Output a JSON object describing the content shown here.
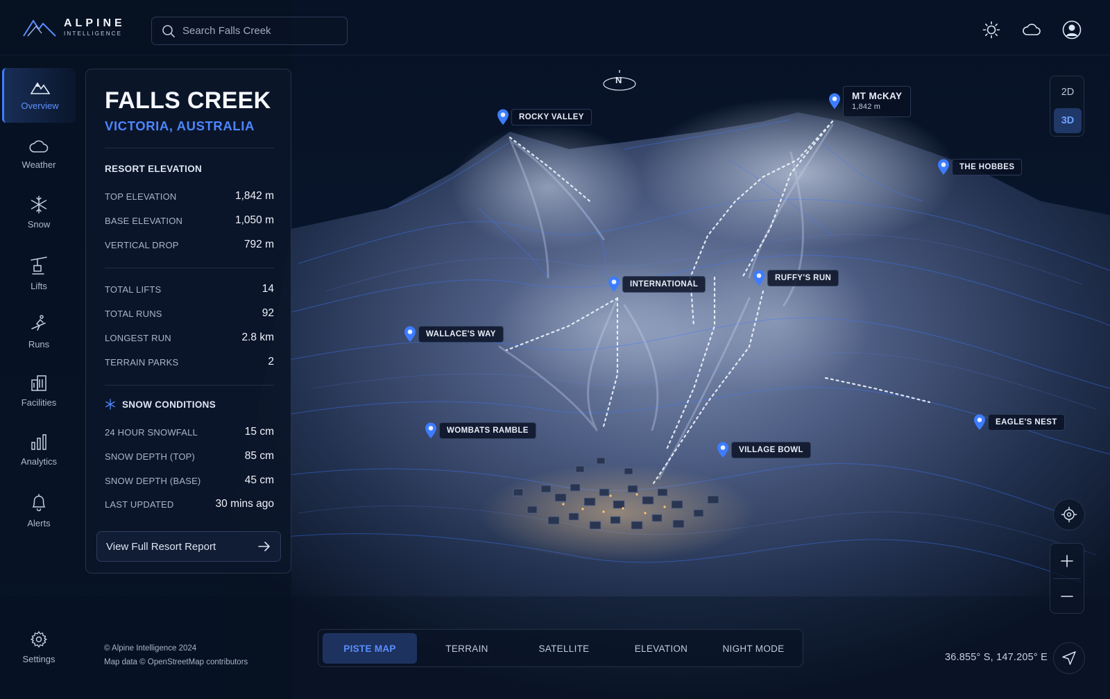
{
  "brand": {
    "name": "ALPINE",
    "tagline": "INTELLIGENCE"
  },
  "search": {
    "placeholder": "Search Falls Creek"
  },
  "header_icons": [
    "sun-icon",
    "cloud-icon",
    "user-icon"
  ],
  "nav": {
    "items": [
      {
        "label": "Overview",
        "icon": "mountain-icon",
        "active": true
      },
      {
        "label": "Weather",
        "icon": "cloud-icon"
      },
      {
        "label": "Snow",
        "icon": "snowflake-icon"
      },
      {
        "label": "Lifts",
        "icon": "chairlift-icon"
      },
      {
        "label": "Runs",
        "icon": "skier-icon"
      },
      {
        "label": "Facilities",
        "icon": "building-icon"
      },
      {
        "label": "Analytics",
        "icon": "bar-chart-icon"
      },
      {
        "label": "Alerts",
        "icon": "bell-icon"
      }
    ],
    "settings": "Settings"
  },
  "resort": {
    "name": "FALLS CREEK",
    "region": "VICTORIA, AUSTRALIA",
    "elevation_title": "RESORT ELEVATION",
    "elevation": [
      {
        "label": "TOP ELEVATION",
        "value": "1,842 m"
      },
      {
        "label": "BASE ELEVATION",
        "value": "1,050 m"
      },
      {
        "label": "VERTICAL DROP",
        "value": "792 m"
      }
    ],
    "stats": [
      {
        "label": "TOTAL LIFTS",
        "value": "14"
      },
      {
        "label": "TOTAL RUNS",
        "value": "92"
      },
      {
        "label": "LONGEST RUN",
        "value": "2.8 km"
      },
      {
        "label": "TERRAIN PARKS",
        "value": "2"
      }
    ],
    "snow_title": "SNOW CONDITIONS",
    "snow": [
      {
        "label": "24 HOUR SNOWFALL",
        "value": "15 cm"
      },
      {
        "label": "SNOW DEPTH (TOP)",
        "value": "85 cm"
      },
      {
        "label": "SNOW DEPTH (BASE)",
        "value": "45 cm"
      },
      {
        "label": "LAST UPDATED",
        "value": "30 mins ago"
      }
    ],
    "report_button": "View Full Resort Report"
  },
  "map": {
    "compass": "N",
    "labels": {
      "rocky_valley": "ROCKY VALLEY",
      "mt_mckay": "MT McKAY",
      "mt_mckay_elev": "1,842 m",
      "the_hobbes": "THE HOBBES",
      "international": "INTERNATIONAL",
      "ruffys_run": "RUFFY'S RUN",
      "wallaces_way": "WALLACE'S WAY",
      "wombats_ramble": "WOMBATS RAMBLE",
      "village_bowl": "VILLAGE BOWL",
      "eagles_nest": "EAGLE'S NEST"
    },
    "view_modes": {
      "two_d": "2D",
      "three_d": "3D",
      "active": "3D"
    },
    "tabs": [
      "PISTE MAP",
      "TERRAIN",
      "SATELLITE",
      "ELEVATION",
      "NIGHT MODE"
    ],
    "active_tab": "PISTE MAP",
    "coordinates": "36.855° S,  147.205° E"
  },
  "footer": {
    "copyright": "© Alpine Intelligence 2024",
    "attribution": "Map data © OpenStreetMap contributors"
  },
  "colors": {
    "accent": "#4d86ff",
    "background": "#06101f",
    "panel": "#0c162a"
  }
}
